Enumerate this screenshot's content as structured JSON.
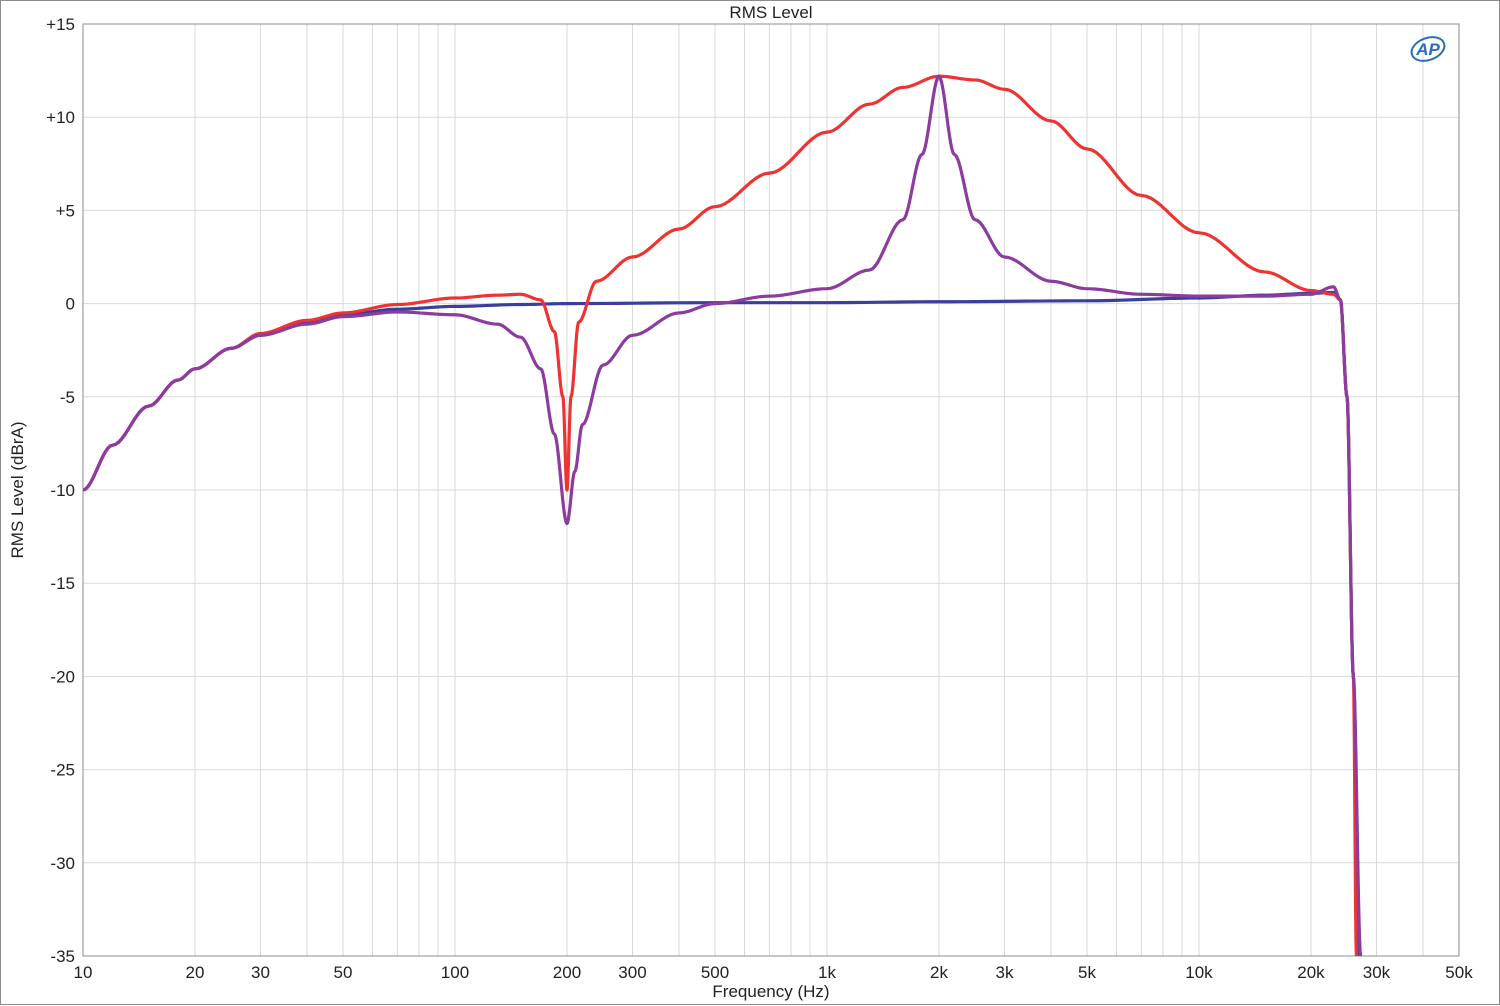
{
  "chart_data": {
    "type": "line",
    "title": "RMS Level",
    "xlabel": "Frequency (Hz)",
    "ylabel": "RMS Level (dBrA)",
    "xscale": "log",
    "xlim": [
      10,
      50000
    ],
    "ylim": [
      -35,
      15
    ],
    "grid": true,
    "x_ticks": [
      10,
      20,
      30,
      50,
      100,
      200,
      300,
      500,
      1000,
      2000,
      3000,
      5000,
      10000,
      20000,
      30000,
      50000
    ],
    "x_tick_labels": [
      "10",
      "20",
      "30",
      "50",
      "100",
      "200",
      "300",
      "500",
      "1k",
      "2k",
      "3k",
      "5k",
      "10k",
      "20k",
      "30k",
      "50k"
    ],
    "y_ticks": [
      15,
      10,
      5,
      0,
      -5,
      -10,
      -15,
      -20,
      -25,
      -30,
      -35
    ],
    "y_tick_labels": [
      "+15",
      "+10",
      "+5",
      "0",
      "-5",
      "-10",
      "-15",
      "-20",
      "-25",
      "-30",
      "-35"
    ],
    "series": [
      {
        "color": "#3a3f9e",
        "points": [
          [
            10,
            -10
          ],
          [
            12,
            -7.6
          ],
          [
            15,
            -5.5
          ],
          [
            18,
            -4.1
          ],
          [
            20,
            -3.5
          ],
          [
            25,
            -2.4
          ],
          [
            30,
            -1.7
          ],
          [
            40,
            -1.0
          ],
          [
            50,
            -0.6
          ],
          [
            70,
            -0.3
          ],
          [
            100,
            -0.15
          ],
          [
            150,
            -0.05
          ],
          [
            200,
            0
          ],
          [
            500,
            0.05
          ],
          [
            1000,
            0.05
          ],
          [
            2000,
            0.1
          ],
          [
            5000,
            0.15
          ],
          [
            10000,
            0.3
          ],
          [
            15000,
            0.45
          ],
          [
            20000,
            0.55
          ],
          [
            23000,
            0.6
          ],
          [
            24000,
            0.2
          ],
          [
            25000,
            -5
          ],
          [
            26000,
            -20
          ],
          [
            27000,
            -35
          ]
        ]
      },
      {
        "color": "#ee3333",
        "points": [
          [
            10,
            -10
          ],
          [
            12,
            -7.6
          ],
          [
            15,
            -5.5
          ],
          [
            18,
            -4.1
          ],
          [
            20,
            -3.5
          ],
          [
            25,
            -2.4
          ],
          [
            30,
            -1.6
          ],
          [
            40,
            -0.9
          ],
          [
            50,
            -0.5
          ],
          [
            70,
            -0.05
          ],
          [
            100,
            0.3
          ],
          [
            130,
            0.45
          ],
          [
            150,
            0.5
          ],
          [
            170,
            0.2
          ],
          [
            185,
            -1.5
          ],
          [
            195,
            -5
          ],
          [
            200,
            -10
          ],
          [
            205,
            -5
          ],
          [
            215,
            -1
          ],
          [
            240,
            1.2
          ],
          [
            300,
            2.5
          ],
          [
            400,
            4
          ],
          [
            500,
            5.2
          ],
          [
            700,
            7
          ],
          [
            1000,
            9.2
          ],
          [
            1300,
            10.7
          ],
          [
            1600,
            11.6
          ],
          [
            2000,
            12.2
          ],
          [
            2500,
            12
          ],
          [
            3000,
            11.5
          ],
          [
            4000,
            9.8
          ],
          [
            5000,
            8.3
          ],
          [
            7000,
            5.8
          ],
          [
            10000,
            3.8
          ],
          [
            15000,
            1.7
          ],
          [
            20000,
            0.7
          ],
          [
            23000,
            0.5
          ],
          [
            24000,
            0.2
          ],
          [
            25000,
            -5
          ],
          [
            26000,
            -20
          ],
          [
            26500,
            -35
          ]
        ]
      },
      {
        "color": "#8b3c9e",
        "points": [
          [
            10,
            -10
          ],
          [
            12,
            -7.6
          ],
          [
            15,
            -5.5
          ],
          [
            18,
            -4.1
          ],
          [
            20,
            -3.5
          ],
          [
            25,
            -2.4
          ],
          [
            30,
            -1.7
          ],
          [
            40,
            -1.1
          ],
          [
            50,
            -0.7
          ],
          [
            70,
            -0.45
          ],
          [
            100,
            -0.6
          ],
          [
            130,
            -1.1
          ],
          [
            150,
            -1.8
          ],
          [
            170,
            -3.5
          ],
          [
            185,
            -7
          ],
          [
            200,
            -11.8
          ],
          [
            210,
            -9
          ],
          [
            220,
            -6.5
          ],
          [
            250,
            -3.3
          ],
          [
            300,
            -1.7
          ],
          [
            400,
            -0.5
          ],
          [
            500,
            0
          ],
          [
            700,
            0.4
          ],
          [
            1000,
            0.8
          ],
          [
            1300,
            1.8
          ],
          [
            1600,
            4.5
          ],
          [
            1800,
            8
          ],
          [
            2000,
            12.2
          ],
          [
            2200,
            8
          ],
          [
            2500,
            4.5
          ],
          [
            3000,
            2.5
          ],
          [
            4000,
            1.2
          ],
          [
            5000,
            0.8
          ],
          [
            7000,
            0.5
          ],
          [
            10000,
            0.4
          ],
          [
            15000,
            0.4
          ],
          [
            20000,
            0.5
          ],
          [
            23000,
            0.9
          ],
          [
            24000,
            0.2
          ],
          [
            25000,
            -5
          ],
          [
            26000,
            -20
          ],
          [
            27200,
            -35
          ]
        ]
      }
    ]
  },
  "logo": {
    "text": "AP"
  }
}
